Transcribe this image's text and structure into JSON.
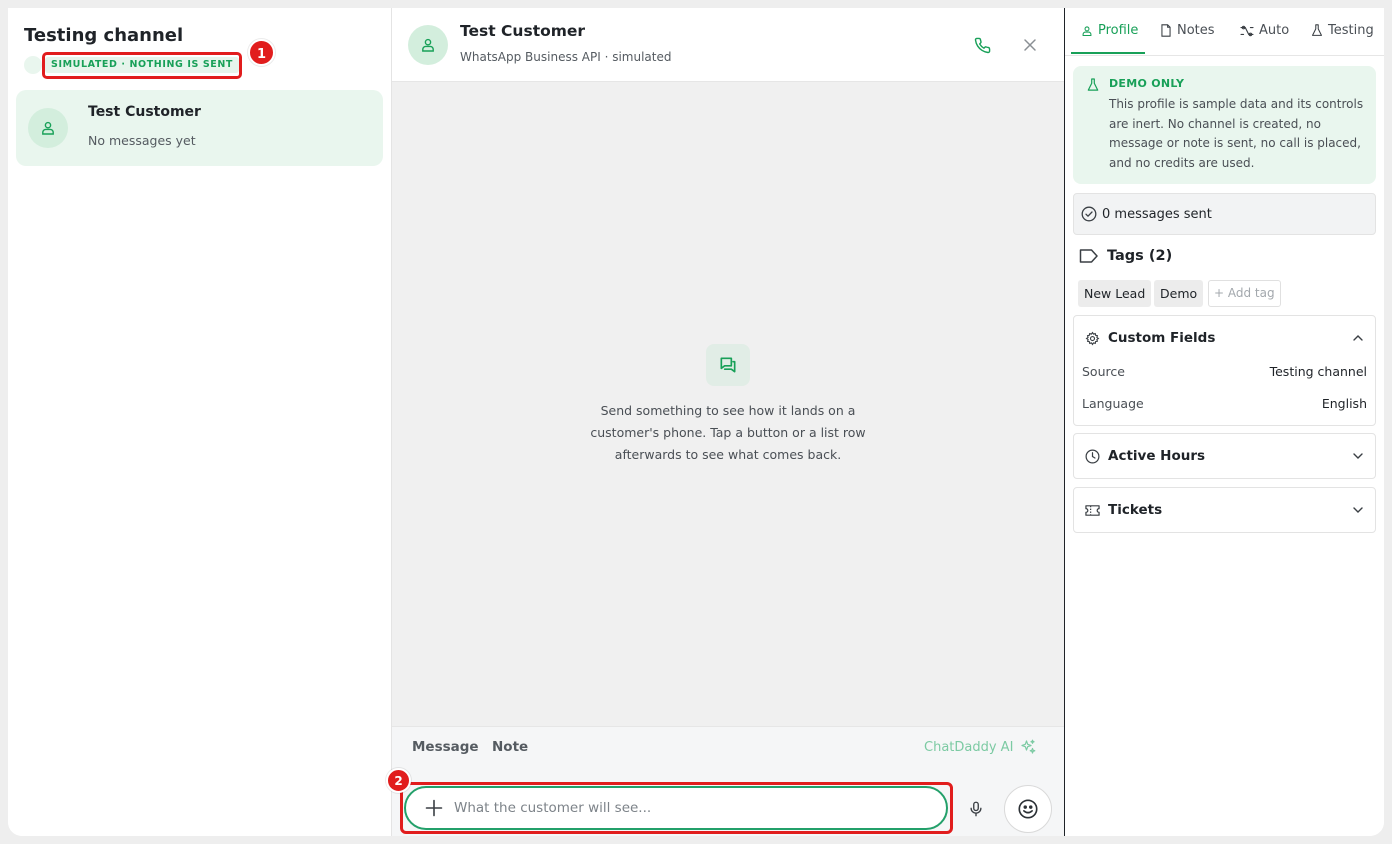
{
  "sidebar": {
    "title": "Testing channel",
    "badge": "SIMULATED · NOTHING IS SENT",
    "conversation": {
      "name": "Test Customer",
      "preview": "No messages yet"
    }
  },
  "chat": {
    "header": {
      "name": "Test Customer",
      "subtitle": "WhatsApp Business API · simulated"
    },
    "empty_state": "Send something to see how it lands on a customer's phone. Tap a button or a list row afterwards to see what comes back.",
    "composer": {
      "tab_message": "Message",
      "tab_note": "Note",
      "ai_label": "ChatDaddy AI",
      "placeholder": "What the customer will see..."
    }
  },
  "panel": {
    "tabs": [
      {
        "label": "Profile",
        "icon": "user-icon",
        "active": true
      },
      {
        "label": "Notes",
        "icon": "file-icon"
      },
      {
        "label": "Auto",
        "icon": "auto-icon"
      },
      {
        "label": "Testing",
        "icon": "flask-icon"
      }
    ],
    "demo": {
      "title": "DEMO ONLY",
      "body": "This profile is sample data and its controls are inert. No channel is created, no message or note is sent, no call is placed, and no credits are used."
    },
    "messages_sent": "0 messages sent",
    "tags": {
      "title": "Tags (2)",
      "items": [
        "New Lead",
        "Demo"
      ],
      "add_label": "+ Add tag"
    },
    "custom_fields": {
      "title": "Custom Fields",
      "rows": [
        {
          "key": "Source",
          "value": "Testing channel"
        },
        {
          "key": "Language",
          "value": "English"
        }
      ]
    },
    "active_hours": {
      "title": "Active Hours"
    },
    "tickets": {
      "title": "Tickets"
    }
  },
  "annotations": [
    "1",
    "2"
  ],
  "colors": {
    "accent": "#18a058",
    "highlight": "#e11d1d",
    "chat_bg": "#f0f0f0"
  }
}
